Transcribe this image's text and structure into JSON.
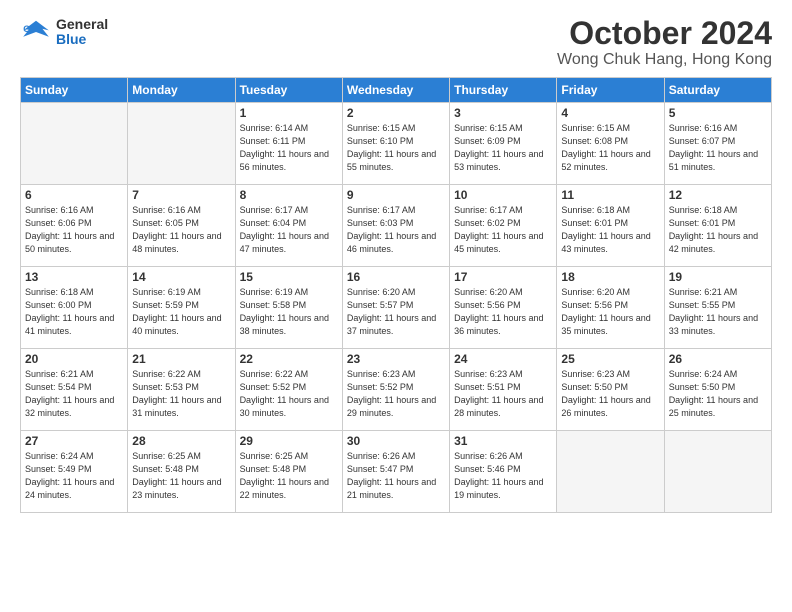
{
  "logo": {
    "general": "General",
    "blue": "Blue"
  },
  "title": "October 2024",
  "location": "Wong Chuk Hang, Hong Kong",
  "days_of_week": [
    "Sunday",
    "Monday",
    "Tuesday",
    "Wednesday",
    "Thursday",
    "Friday",
    "Saturday"
  ],
  "weeks": [
    [
      {
        "day": "",
        "sunrise": "",
        "sunset": "",
        "daylight": ""
      },
      {
        "day": "",
        "sunrise": "",
        "sunset": "",
        "daylight": ""
      },
      {
        "day": "1",
        "sunrise": "Sunrise: 6:14 AM",
        "sunset": "Sunset: 6:11 PM",
        "daylight": "Daylight: 11 hours and 56 minutes."
      },
      {
        "day": "2",
        "sunrise": "Sunrise: 6:15 AM",
        "sunset": "Sunset: 6:10 PM",
        "daylight": "Daylight: 11 hours and 55 minutes."
      },
      {
        "day": "3",
        "sunrise": "Sunrise: 6:15 AM",
        "sunset": "Sunset: 6:09 PM",
        "daylight": "Daylight: 11 hours and 53 minutes."
      },
      {
        "day": "4",
        "sunrise": "Sunrise: 6:15 AM",
        "sunset": "Sunset: 6:08 PM",
        "daylight": "Daylight: 11 hours and 52 minutes."
      },
      {
        "day": "5",
        "sunrise": "Sunrise: 6:16 AM",
        "sunset": "Sunset: 6:07 PM",
        "daylight": "Daylight: 11 hours and 51 minutes."
      }
    ],
    [
      {
        "day": "6",
        "sunrise": "Sunrise: 6:16 AM",
        "sunset": "Sunset: 6:06 PM",
        "daylight": "Daylight: 11 hours and 50 minutes."
      },
      {
        "day": "7",
        "sunrise": "Sunrise: 6:16 AM",
        "sunset": "Sunset: 6:05 PM",
        "daylight": "Daylight: 11 hours and 48 minutes."
      },
      {
        "day": "8",
        "sunrise": "Sunrise: 6:17 AM",
        "sunset": "Sunset: 6:04 PM",
        "daylight": "Daylight: 11 hours and 47 minutes."
      },
      {
        "day": "9",
        "sunrise": "Sunrise: 6:17 AM",
        "sunset": "Sunset: 6:03 PM",
        "daylight": "Daylight: 11 hours and 46 minutes."
      },
      {
        "day": "10",
        "sunrise": "Sunrise: 6:17 AM",
        "sunset": "Sunset: 6:02 PM",
        "daylight": "Daylight: 11 hours and 45 minutes."
      },
      {
        "day": "11",
        "sunrise": "Sunrise: 6:18 AM",
        "sunset": "Sunset: 6:01 PM",
        "daylight": "Daylight: 11 hours and 43 minutes."
      },
      {
        "day": "12",
        "sunrise": "Sunrise: 6:18 AM",
        "sunset": "Sunset: 6:01 PM",
        "daylight": "Daylight: 11 hours and 42 minutes."
      }
    ],
    [
      {
        "day": "13",
        "sunrise": "Sunrise: 6:18 AM",
        "sunset": "Sunset: 6:00 PM",
        "daylight": "Daylight: 11 hours and 41 minutes."
      },
      {
        "day": "14",
        "sunrise": "Sunrise: 6:19 AM",
        "sunset": "Sunset: 5:59 PM",
        "daylight": "Daylight: 11 hours and 40 minutes."
      },
      {
        "day": "15",
        "sunrise": "Sunrise: 6:19 AM",
        "sunset": "Sunset: 5:58 PM",
        "daylight": "Daylight: 11 hours and 38 minutes."
      },
      {
        "day": "16",
        "sunrise": "Sunrise: 6:20 AM",
        "sunset": "Sunset: 5:57 PM",
        "daylight": "Daylight: 11 hours and 37 minutes."
      },
      {
        "day": "17",
        "sunrise": "Sunrise: 6:20 AM",
        "sunset": "Sunset: 5:56 PM",
        "daylight": "Daylight: 11 hours and 36 minutes."
      },
      {
        "day": "18",
        "sunrise": "Sunrise: 6:20 AM",
        "sunset": "Sunset: 5:56 PM",
        "daylight": "Daylight: 11 hours and 35 minutes."
      },
      {
        "day": "19",
        "sunrise": "Sunrise: 6:21 AM",
        "sunset": "Sunset: 5:55 PM",
        "daylight": "Daylight: 11 hours and 33 minutes."
      }
    ],
    [
      {
        "day": "20",
        "sunrise": "Sunrise: 6:21 AM",
        "sunset": "Sunset: 5:54 PM",
        "daylight": "Daylight: 11 hours and 32 minutes."
      },
      {
        "day": "21",
        "sunrise": "Sunrise: 6:22 AM",
        "sunset": "Sunset: 5:53 PM",
        "daylight": "Daylight: 11 hours and 31 minutes."
      },
      {
        "day": "22",
        "sunrise": "Sunrise: 6:22 AM",
        "sunset": "Sunset: 5:52 PM",
        "daylight": "Daylight: 11 hours and 30 minutes."
      },
      {
        "day": "23",
        "sunrise": "Sunrise: 6:23 AM",
        "sunset": "Sunset: 5:52 PM",
        "daylight": "Daylight: 11 hours and 29 minutes."
      },
      {
        "day": "24",
        "sunrise": "Sunrise: 6:23 AM",
        "sunset": "Sunset: 5:51 PM",
        "daylight": "Daylight: 11 hours and 28 minutes."
      },
      {
        "day": "25",
        "sunrise": "Sunrise: 6:23 AM",
        "sunset": "Sunset: 5:50 PM",
        "daylight": "Daylight: 11 hours and 26 minutes."
      },
      {
        "day": "26",
        "sunrise": "Sunrise: 6:24 AM",
        "sunset": "Sunset: 5:50 PM",
        "daylight": "Daylight: 11 hours and 25 minutes."
      }
    ],
    [
      {
        "day": "27",
        "sunrise": "Sunrise: 6:24 AM",
        "sunset": "Sunset: 5:49 PM",
        "daylight": "Daylight: 11 hours and 24 minutes."
      },
      {
        "day": "28",
        "sunrise": "Sunrise: 6:25 AM",
        "sunset": "Sunset: 5:48 PM",
        "daylight": "Daylight: 11 hours and 23 minutes."
      },
      {
        "day": "29",
        "sunrise": "Sunrise: 6:25 AM",
        "sunset": "Sunset: 5:48 PM",
        "daylight": "Daylight: 11 hours and 22 minutes."
      },
      {
        "day": "30",
        "sunrise": "Sunrise: 6:26 AM",
        "sunset": "Sunset: 5:47 PM",
        "daylight": "Daylight: 11 hours and 21 minutes."
      },
      {
        "day": "31",
        "sunrise": "Sunrise: 6:26 AM",
        "sunset": "Sunset: 5:46 PM",
        "daylight": "Daylight: 11 hours and 19 minutes."
      },
      {
        "day": "",
        "sunrise": "",
        "sunset": "",
        "daylight": ""
      },
      {
        "day": "",
        "sunrise": "",
        "sunset": "",
        "daylight": ""
      }
    ]
  ]
}
